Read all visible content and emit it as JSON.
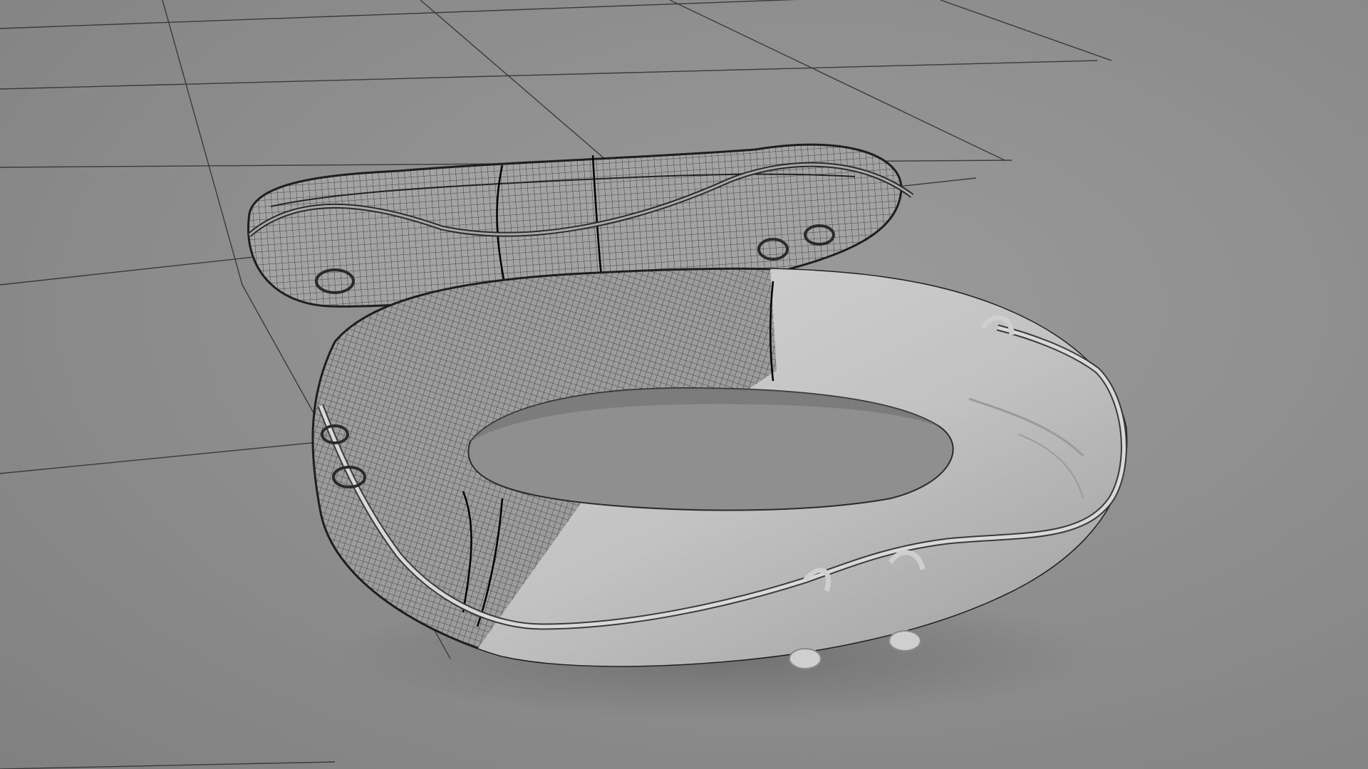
{
  "scene": {
    "background_color": "#8f8f8f",
    "grid_color": "#333333",
    "wireframe_color": "#1e1e1e",
    "shaded_color": "#c9c9c9",
    "objects": [
      {
        "name": "lifebuoy-upright",
        "display": "wireframe"
      },
      {
        "name": "lifebuoy-flat",
        "display": "wireframe-and-shaded"
      }
    ]
  }
}
